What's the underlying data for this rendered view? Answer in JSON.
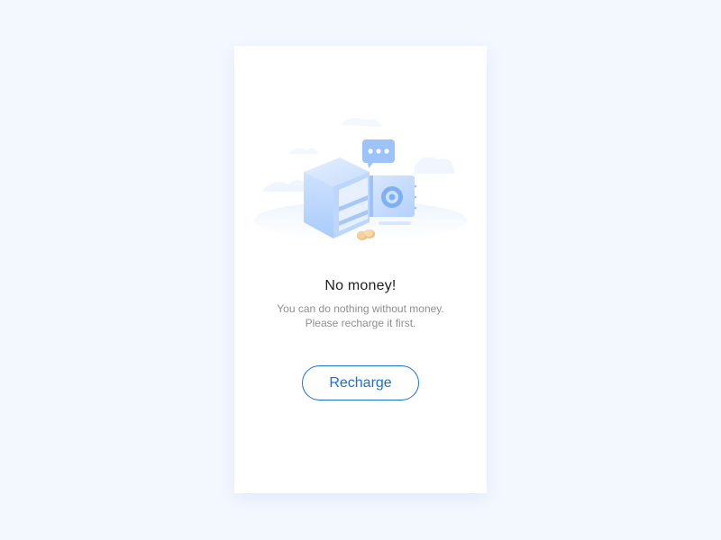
{
  "empty_state": {
    "title": "No money!",
    "description_line1": "You can do nothing without money.",
    "description_line2": "Please recharge it first.",
    "button_label": "Recharge"
  },
  "illustration": {
    "icons": [
      "open-safe-icon",
      "chat-bubble-icon",
      "coins-icon",
      "cloud-icon"
    ]
  },
  "colors": {
    "page_background": "#f3f7fe",
    "card_background": "#ffffff",
    "accent": "#1a72cf",
    "title_text": "#1f1f1f",
    "secondary_text": "#8f8f8f",
    "illustration_blue": "#a9cbfb",
    "coin": "#f3d39b"
  }
}
